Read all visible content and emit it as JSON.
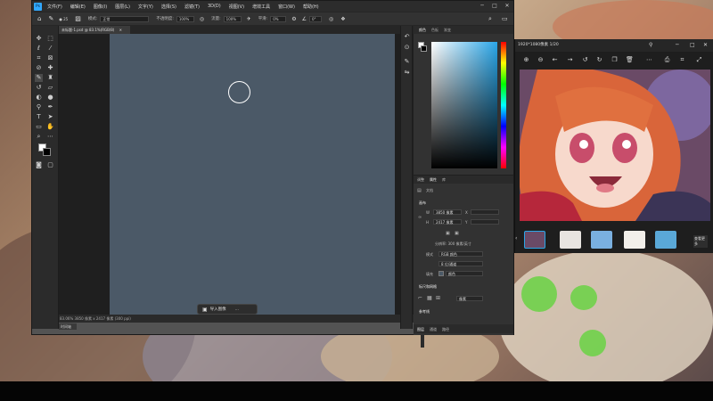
{
  "photoshop": {
    "menu": [
      "文件(F)",
      "编辑(E)",
      "图像(I)",
      "图层(L)",
      "文字(Y)",
      "选择(S)",
      "滤镜(T)",
      "3D(D)",
      "视图(V)",
      "增效工具",
      "窗口(W)",
      "帮助(H)"
    ],
    "options": {
      "mode_label": "模式:",
      "mode_value": "正常",
      "opacity_label": "不透明度:",
      "opacity_value": "100%",
      "flow_label": "流量:",
      "flow_value": "100%",
      "smooth_label": "平滑:",
      "smooth_value": "0%",
      "angle_value": "0°"
    },
    "document_tab": "未标题-1.psd @ 83.1%(RGB/8)",
    "contextual_bar": {
      "import_label": "导入图像",
      "more_label": "..."
    },
    "status_bar": "83.06%  3850 像素 x 2417 像素 (300 ppi)",
    "bottom_label": "时间轴",
    "panel_tabs": [
      "颜色",
      "色板",
      "渐变"
    ],
    "properties": {
      "tabs": [
        "调整",
        "属性",
        "库"
      ],
      "doc_label": "文档",
      "canvas_heading": "画布",
      "width_label": "W",
      "width_value": "3850 像素",
      "height_label": "H",
      "height_value": "2417 像素",
      "x_label": "X",
      "y_label": "Y",
      "resolution_text": "分辨率: 300 像素/英寸",
      "mode_label": "模式",
      "mode_value": "RGB 颜色",
      "bit_value": "8 位/通道",
      "fill_label": "填充",
      "fill_value": "颜色",
      "rulers_heading": "标尺和网格",
      "rulers_unit": "像素",
      "guides_heading": "参考线",
      "footer_tabs": [
        "图层",
        "通道",
        "路径"
      ]
    }
  },
  "viewer": {
    "title": "1920*1080像素  1/20",
    "more_label": "查看更多"
  },
  "colors": {
    "canvas": "#4b5967",
    "accent": "#2aa6e8",
    "panel_bg": "#323232"
  }
}
